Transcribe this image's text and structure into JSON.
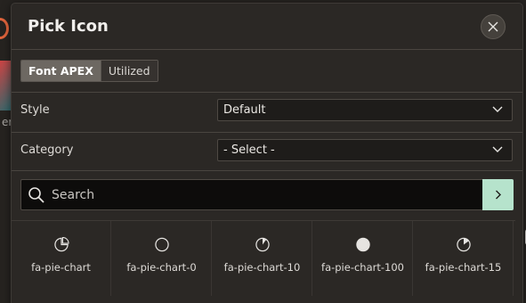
{
  "dialog": {
    "title": "Pick Icon",
    "close_icon": "close-icon"
  },
  "tabs": [
    {
      "label": "Font APEX",
      "active": true
    },
    {
      "label": "Utilized",
      "active": false
    }
  ],
  "style_field": {
    "label": "Style",
    "value": "Default"
  },
  "category_field": {
    "label": "Category",
    "value": "- Select -"
  },
  "search": {
    "placeholder": "Search",
    "value": "",
    "icon": "search-icon",
    "go_icon": "chevron-right-icon"
  },
  "icons": [
    {
      "name": "fa-pie-chart",
      "fill": 0.25
    },
    {
      "name": "fa-pie-chart-0",
      "fill": 0
    },
    {
      "name": "fa-pie-chart-10",
      "fill": 0.1
    },
    {
      "name": "fa-pie-chart-100",
      "fill": 1
    },
    {
      "name": "fa-pie-chart-15",
      "fill": 0.15
    }
  ],
  "background": {
    "partial_text": "er"
  },
  "colors": {
    "accent": "#b6e3cc",
    "dialog_bg": "#2b2825",
    "active_tab": "#6d6862"
  }
}
